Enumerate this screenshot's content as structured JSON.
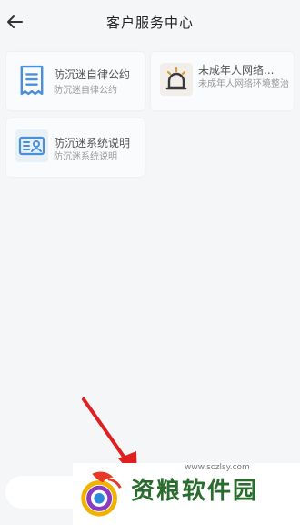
{
  "header": {
    "title": "客户服务中心"
  },
  "cards": [
    {
      "title": "防沉迷自律公约",
      "subtitle": "防沉迷自律公约"
    },
    {
      "title": "未成年人网络...",
      "subtitle": "未成年人网络环境整治"
    },
    {
      "title": "防沉迷系统说明",
      "subtitle": "防沉迷系统说明"
    }
  ],
  "watermark": {
    "url": "www.sczlsy.com",
    "text": "资粮软件园"
  },
  "colors": {
    "icon_blue": "#4a8fd8",
    "dark": "#3a3a3a",
    "watermark_green": "#2a6b2e",
    "arrow_red": "#e02020"
  }
}
